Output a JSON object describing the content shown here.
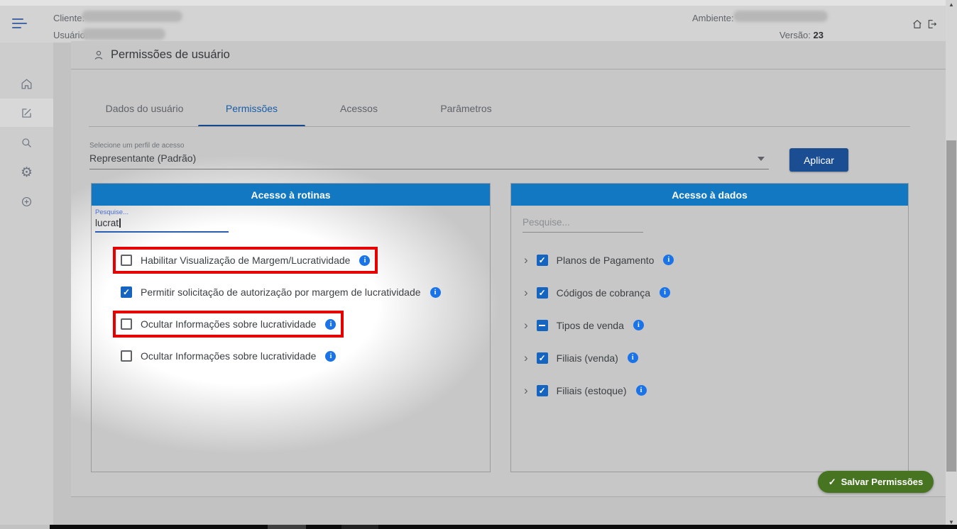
{
  "header": {
    "client_label": "Cliente:",
    "user_label": "Usuário:",
    "environment_label": "Ambiente:",
    "version_label": "Versão:",
    "version_value": "23"
  },
  "sidebar": {
    "items": [
      "home-icon",
      "edit-icon",
      "search-icon",
      "settings-icon",
      "add-icon"
    ],
    "active_item": "edit-icon"
  },
  "page_title": "Permissões de usuário",
  "tabs": [
    {
      "label": "Dados do usuário",
      "active": false
    },
    {
      "label": "Permissões",
      "active": true
    },
    {
      "label": "Acessos",
      "active": false
    },
    {
      "label": "Parâmetros",
      "active": false
    }
  ],
  "profile_select": {
    "label": "Selecione um perfil de acesso",
    "value": "Representante (Padrão)",
    "apply_label": "Aplicar"
  },
  "routines_panel": {
    "title": "Acesso à rotinas",
    "search_label": "Pesquise...",
    "search_value": "lucrat",
    "items": [
      {
        "label": "Habilitar Visualização de Margem/Lucratividade",
        "checked": false,
        "highlighted": true
      },
      {
        "label": "Permitir solicitação de autorização por margem de lucratividade",
        "checked": true,
        "highlighted": false
      },
      {
        "label": "Ocultar Informações sobre lucratividade",
        "checked": false,
        "highlighted": true
      },
      {
        "label": "Ocultar Informações sobre lucratividade",
        "checked": false,
        "highlighted": false
      }
    ]
  },
  "data_panel": {
    "title": "Acesso à dados",
    "search_placeholder": "Pesquise...",
    "items": [
      {
        "label": "Planos de Pagamento",
        "state": "checked"
      },
      {
        "label": "Códigos de cobrança",
        "state": "checked"
      },
      {
        "label": "Tipos de venda",
        "state": "indeterminate"
      },
      {
        "label": "Filiais (venda)",
        "state": "checked"
      },
      {
        "label": "Filiais (estoque)",
        "state": "checked"
      }
    ]
  },
  "save_button_label": "Salvar Permissões",
  "colors": {
    "panel_header": "#1278c2",
    "checkbox": "#1565c0",
    "info": "#1a73e8",
    "apply": "#1b4d93",
    "save": "#477421",
    "red": "#e60000"
  }
}
